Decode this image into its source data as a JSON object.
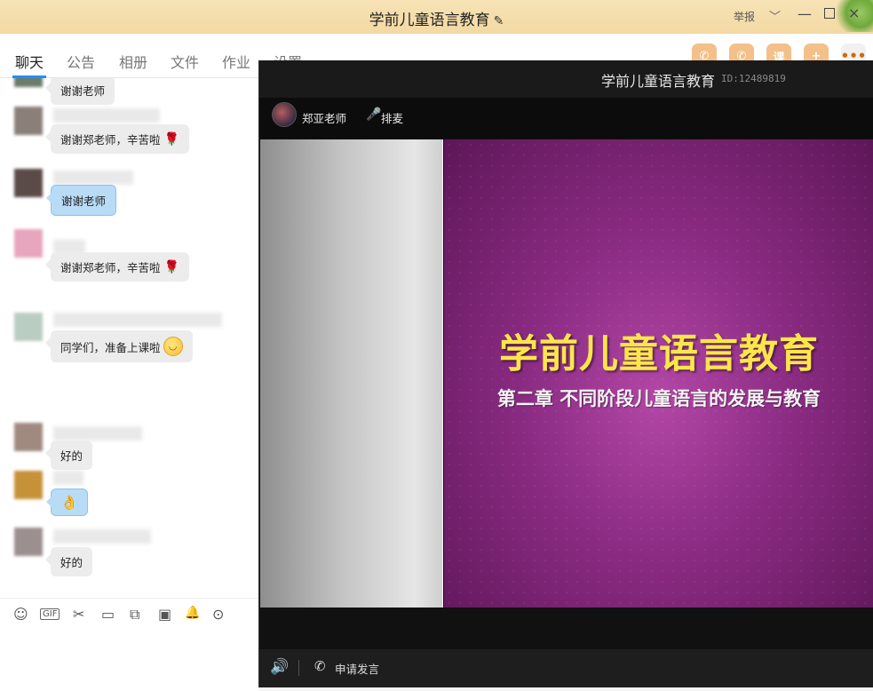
{
  "titlebar": {
    "title": "学前儿童语言教育",
    "edit_icon": "✎",
    "report_label": "举报",
    "chevron": "﹀",
    "minimize": "—",
    "close": "×"
  },
  "tabs": [
    {
      "label": "聊天",
      "active": true
    },
    {
      "label": "公告"
    },
    {
      "label": "相册"
    },
    {
      "label": "文件"
    },
    {
      "label": "作业"
    },
    {
      "label": "设置"
    }
  ],
  "settings_close": "×",
  "right_buttons": [
    {
      "icon": "phone-icon",
      "glyph": "✆"
    },
    {
      "icon": "video-call-icon",
      "glyph": "✆"
    },
    {
      "icon": "course-icon",
      "glyph": "课"
    },
    {
      "icon": "add-app-icon",
      "glyph": "+"
    },
    {
      "icon": "more-icon",
      "glyph": "•••"
    }
  ],
  "messages": [
    {
      "text": "谢谢老师",
      "style": "gray"
    },
    {
      "text": "谢谢郑老师，辛苦啦",
      "style": "gray",
      "emoji": "rose"
    },
    {
      "text": "谢谢老师",
      "style": "blue"
    },
    {
      "text": "谢谢郑老师，辛苦啦",
      "style": "gray",
      "emoji": "rose"
    },
    {
      "text": "同学们，准备上课啦",
      "style": "gray",
      "emoji": "smile"
    },
    {
      "text": "好的",
      "style": "gray"
    },
    {
      "text": "👌",
      "style": "blue"
    },
    {
      "text": "好的",
      "style": "gray"
    }
  ],
  "emoji": {
    "rose": "🌹",
    "smile": "😌"
  },
  "chat_toolbar": [
    {
      "name": "emoji-icon",
      "glyph": "☺"
    },
    {
      "name": "gif-icon",
      "glyph": "GIF"
    },
    {
      "name": "scissors-icon",
      "glyph": "✂"
    },
    {
      "name": "folder-icon",
      "glyph": "▭"
    },
    {
      "name": "image-gallery-icon",
      "glyph": "⧉"
    },
    {
      "name": "image-icon",
      "glyph": "▣"
    },
    {
      "name": "bell-icon",
      "glyph": "🔔"
    },
    {
      "name": "more-circle-icon",
      "glyph": "⊙"
    }
  ],
  "video": {
    "title": "学前儿童语言教育",
    "id_label": "ID:12489819",
    "teacher_name": "郑亚老师",
    "mic_icon": "🎤",
    "queue_label": "排麦",
    "slide_title": "学前儿童语言教育",
    "slide_subtitle": "第二章  不同阶段儿童语言的发展与教育",
    "speaker_icon": "🔊",
    "phone_icon": "✆",
    "request_label": "申请发言"
  }
}
